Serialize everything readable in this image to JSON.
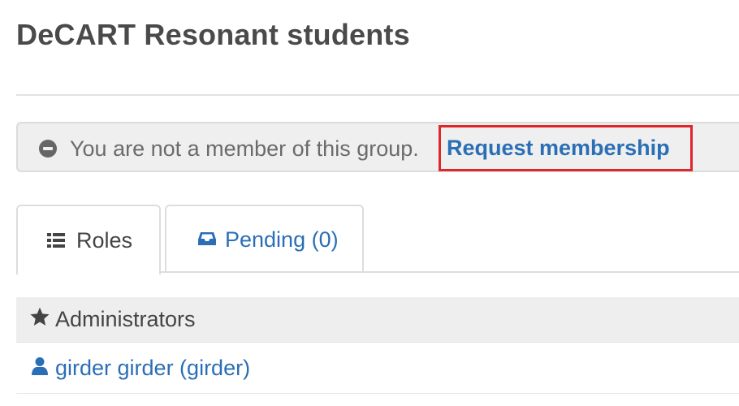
{
  "page": {
    "title": "DeCART Resonant students"
  },
  "notice": {
    "icon": "minus-circle-icon",
    "text": "You are not a member of this group.",
    "request_label": "Request membership",
    "highlight_color": "#e0252b",
    "link_color": "#2a6fb5"
  },
  "tabs": [
    {
      "label": "Roles",
      "icon": "list-icon",
      "active": true
    },
    {
      "label": "Pending (0)",
      "icon": "inbox-icon",
      "active": false
    }
  ],
  "roles": {
    "section_icon": "star-icon",
    "section_title": "Administrators",
    "members": [
      {
        "icon": "user-icon",
        "label": "girder girder (girder)"
      }
    ]
  }
}
